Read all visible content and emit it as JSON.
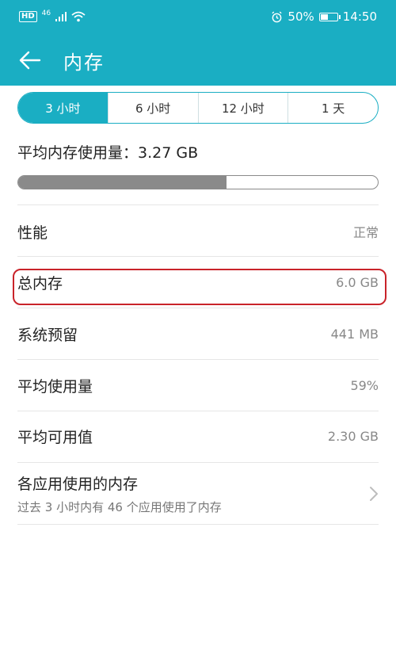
{
  "status": {
    "hd": "HD",
    "network": "46",
    "battery": "50%",
    "battery_level": 0.5,
    "time": "14:50"
  },
  "header": {
    "title": "内存"
  },
  "tabs": [
    {
      "label": "3 小时",
      "active": true
    },
    {
      "label": "6 小时",
      "active": false
    },
    {
      "label": "12 小时",
      "active": false
    },
    {
      "label": "1 天",
      "active": false
    }
  ],
  "summary": {
    "average_label": "平均内存使用量：3.27 GB",
    "usage_fraction": 0.58
  },
  "rows": [
    {
      "label": "性能",
      "value": "正常"
    },
    {
      "label": "总内存",
      "value": "6.0 GB"
    },
    {
      "label": "系统预留",
      "value": "441 MB"
    },
    {
      "label": "平均使用量",
      "value": "59%"
    },
    {
      "label": "平均可用值",
      "value": "2.30 GB"
    }
  ],
  "apps_row": {
    "title": "各应用使用的内存",
    "subtitle": "过去 3 小时内有 46 个应用使用了内存"
  },
  "colors": {
    "accent": "#1aaec3",
    "highlight": "#c9232a",
    "bar": "#8a8a8a"
  }
}
